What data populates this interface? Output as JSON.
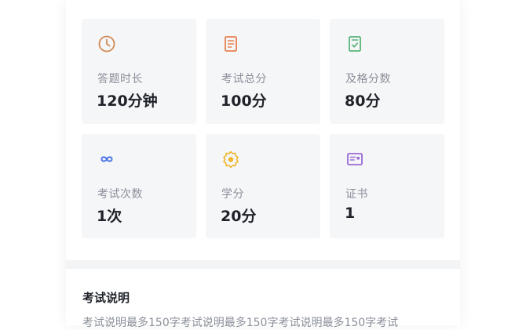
{
  "info_tiles": [
    {
      "icon": "clock-icon",
      "label": "答题时长",
      "value": "120分钟",
      "color": "#d08a55"
    },
    {
      "icon": "score-sheet-icon",
      "label": "考试总分",
      "value": "100分",
      "color": "#e8804f"
    },
    {
      "icon": "pass-check-icon",
      "label": "及格分数",
      "value": "80分",
      "color": "#5bb37a"
    },
    {
      "icon": "infinity-icon",
      "label": "考试次数",
      "value": "1次",
      "color": "#4a73e8"
    },
    {
      "icon": "credit-badge-icon",
      "label": "学分",
      "value": "20分",
      "color": "#f0b429"
    },
    {
      "icon": "certificate-icon",
      "label": "证书",
      "value": "1",
      "color": "#9b6ad6"
    }
  ],
  "description": {
    "title": "考试说明",
    "text": "考试说明最多150字考试说明最多150字考试说明最多150字考试"
  }
}
